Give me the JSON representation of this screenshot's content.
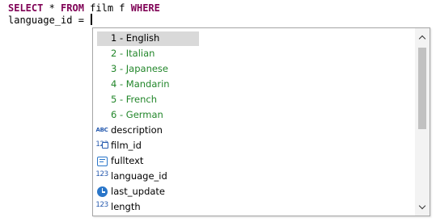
{
  "editor": {
    "line1": {
      "kw_select": "SELECT",
      "star": " * ",
      "kw_from": "FROM",
      "table": " film f ",
      "kw_where": "WHERE"
    },
    "line2": "language_id = "
  },
  "autocomplete": {
    "values": [
      {
        "label": "1 - English",
        "selected": true
      },
      {
        "label": "2 - Italian"
      },
      {
        "label": "3 - Japanese"
      },
      {
        "label": "4 - Mandarin"
      },
      {
        "label": "5 - French"
      },
      {
        "label": "6 - German"
      }
    ],
    "columns": [
      {
        "label": "description",
        "icon": "text-column-icon",
        "icon_glyph": "ABC"
      },
      {
        "label": "film_id",
        "icon": "numeric-key-column-icon",
        "icon_glyph": "123"
      },
      {
        "label": "fulltext",
        "icon": "fulltext-column-icon"
      },
      {
        "label": "language_id",
        "icon": "numeric-column-icon",
        "icon_glyph": "123"
      },
      {
        "label": "last_update",
        "icon": "clock-column-icon"
      },
      {
        "label": "length",
        "icon": "numeric-column-icon",
        "icon_glyph": "123"
      }
    ]
  },
  "colors": {
    "keyword": "#7f0055",
    "value_item": "#22862a",
    "selection": "#d9d9d9",
    "icon_blue": "#2a76c9"
  }
}
